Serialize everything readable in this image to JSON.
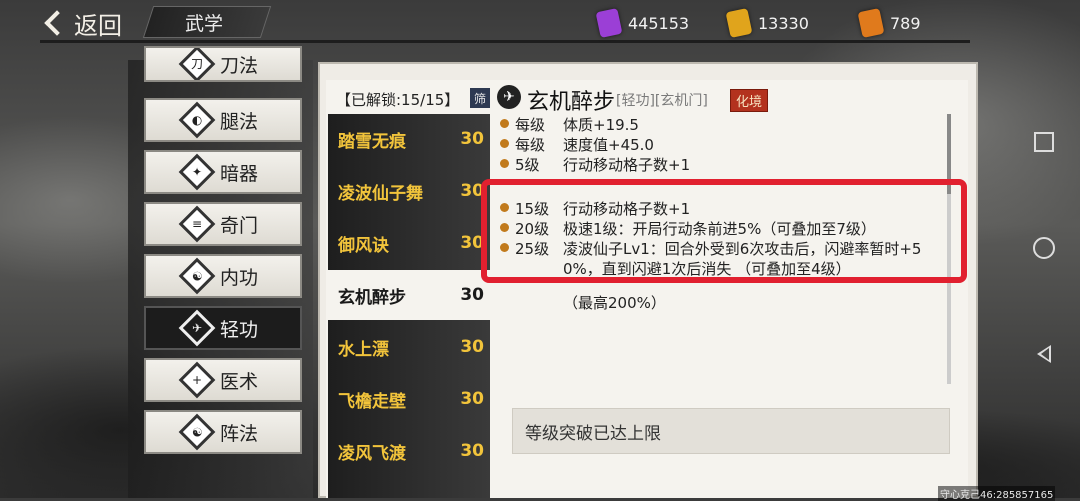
{
  "header": {
    "back_label": "返回",
    "title": "武学"
  },
  "resources": [
    {
      "icon": "purple-scroll-icon",
      "color": "#9b3fd6",
      "value": "445153"
    },
    {
      "icon": "gold-scroll-icon",
      "color": "#e0a41c",
      "value": "13330"
    },
    {
      "icon": "orange-scroll-icon",
      "color": "#e07a1c",
      "value": "789"
    }
  ],
  "sidebar": {
    "items": [
      {
        "label": "刀法",
        "icon": "blade-icon"
      },
      {
        "label": "腿法",
        "icon": "leg-icon"
      },
      {
        "label": "暗器",
        "icon": "shuriken-icon"
      },
      {
        "label": "奇门",
        "icon": "scroll-icon"
      },
      {
        "label": "内功",
        "icon": "meditation-icon"
      },
      {
        "label": "轻功",
        "icon": "running-icon"
      },
      {
        "label": "医术",
        "icon": "medicine-icon"
      },
      {
        "label": "阵法",
        "icon": "taiji-icon"
      }
    ],
    "active": "轻功"
  },
  "list": {
    "unlocked_label": "【已解锁:15/15】",
    "filter_label": "筛",
    "items": [
      {
        "name": "踏雪无痕",
        "level": "30"
      },
      {
        "name": "凌波仙子舞",
        "level": "30"
      },
      {
        "name": "御风诀",
        "level": "30"
      },
      {
        "name": "玄机醉步",
        "level": "30"
      },
      {
        "name": "水上漂",
        "level": "30"
      },
      {
        "name": "飞檐走壁",
        "level": "30"
      },
      {
        "name": "凌风飞渡",
        "level": "30"
      }
    ],
    "active": "玄机醉步"
  },
  "detail": {
    "name": "玄机醉步",
    "tags": "[轻功][玄机门]",
    "realm": "化境",
    "lines": [
      {
        "level": "每级",
        "text": "体质+19.5"
      },
      {
        "level": "每级",
        "text": "速度值+45.0"
      },
      {
        "level": "5级",
        "text": "行动移动格子数+1"
      },
      {
        "level": "15级",
        "text": "行动移动格子数+1"
      },
      {
        "level": "20级",
        "text": "极速1级：开局行动条前进5%（可叠加至7级）"
      },
      {
        "level": "25级",
        "text": "凌波仙子Lv1：回合外受到6次攻击后，闪避率暂时+5"
      },
      {
        "level": "",
        "text": "0%，直到闪避1次后消失 （可叠加至4级）"
      },
      {
        "level": "",
        "text": "（最高200%）"
      }
    ],
    "limit_text": "等级突破已达上限"
  },
  "watermark": "守心克己46:285857165"
}
